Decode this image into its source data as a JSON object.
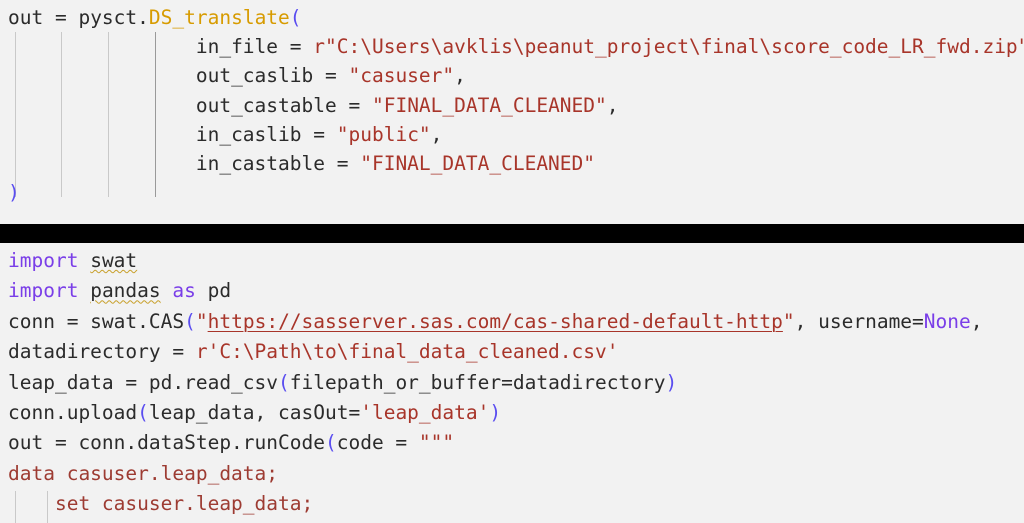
{
  "editor": {
    "background_color": "#f2f2f2",
    "separator_color": "#000000",
    "colors": {
      "plain_text": "#2b2b2b",
      "keyword": "#7a3ee8",
      "function": "#d79b00",
      "bracket": "#5a4df0",
      "string": "#a8352a",
      "argument": "#7a4fd8",
      "spellcheck_squiggle": "#c8a02a"
    }
  },
  "block_top": {
    "lines": [
      {
        "id": "line-1",
        "tokens": [
          {
            "text": "out = ",
            "style": "plain"
          },
          {
            "text": "pysct",
            "style": "plain"
          },
          {
            "text": ".",
            "style": "plain"
          },
          {
            "text": "DS_translate",
            "style": "func"
          },
          {
            "text": "(",
            "style": "paren"
          }
        ],
        "plain": "out = pysct.DS_translate("
      },
      {
        "id": "line-2",
        "tokens": [
          {
            "text": "                ",
            "style": "plain"
          },
          {
            "text": "in_file",
            "style": "arg"
          },
          {
            "text": " = ",
            "style": "plain"
          },
          {
            "text": "r",
            "style": "prefix"
          },
          {
            "text": "\"C:\\Users\\avklis\\peanut_project\\final\\score_code_LR_fwd.zip\"",
            "style": "str"
          }
        ],
        "plain": "                in_file = r\"C:\\Users\\avklis\\peanut_project\\final\\score_code_LR_fwd.zip\","
      },
      {
        "id": "line-3",
        "tokens": [
          {
            "text": "                ",
            "style": "plain"
          },
          {
            "text": "out_caslib",
            "style": "arg"
          },
          {
            "text": " = ",
            "style": "plain"
          },
          {
            "text": "\"casuser\"",
            "style": "str"
          },
          {
            "text": ",",
            "style": "plain"
          }
        ],
        "plain": "                out_caslib = \"casuser\","
      },
      {
        "id": "line-4",
        "tokens": [
          {
            "text": "                ",
            "style": "plain"
          },
          {
            "text": "out_castable",
            "style": "arg"
          },
          {
            "text": " = ",
            "style": "plain"
          },
          {
            "text": "\"FINAL_DATA_CLEANED\"",
            "style": "str"
          },
          {
            "text": ",",
            "style": "plain"
          }
        ],
        "plain": "                out_castable = \"FINAL_DATA_CLEANED\","
      },
      {
        "id": "line-5",
        "tokens": [
          {
            "text": "                ",
            "style": "plain"
          },
          {
            "text": "in_caslib",
            "style": "arg"
          },
          {
            "text": " = ",
            "style": "plain"
          },
          {
            "text": "\"public\"",
            "style": "str"
          },
          {
            "text": ",",
            "style": "plain"
          }
        ],
        "plain": "                in_caslib = \"public\","
      },
      {
        "id": "line-6",
        "tokens": [
          {
            "text": "                ",
            "style": "plain"
          },
          {
            "text": "in_castable",
            "style": "arg"
          },
          {
            "text": " = ",
            "style": "plain"
          },
          {
            "text": "\"FINAL_DATA_CLEANED\"",
            "style": "str"
          }
        ],
        "plain": "                in_castable = \"FINAL_DATA_CLEANED\""
      },
      {
        "id": "line-7",
        "tokens": [
          {
            "text": ")",
            "style": "paren"
          }
        ],
        "plain": ")"
      }
    ]
  },
  "block_bottom": {
    "lines": [
      {
        "id": "line-8",
        "tokens": [
          {
            "text": "import",
            "style": "kw"
          },
          {
            "text": " ",
            "style": "plain"
          },
          {
            "text": "swat",
            "style": "squiggle"
          }
        ],
        "plain": "import swat"
      },
      {
        "id": "line-9",
        "tokens": [
          {
            "text": "import",
            "style": "kw"
          },
          {
            "text": " ",
            "style": "plain"
          },
          {
            "text": "pandas",
            "style": "squiggle"
          },
          {
            "text": " ",
            "style": "plain"
          },
          {
            "text": "as",
            "style": "kw"
          },
          {
            "text": " ",
            "style": "plain"
          },
          {
            "text": "pd",
            "style": "plain"
          }
        ],
        "plain": "import pandas as pd"
      },
      {
        "id": "line-10",
        "tokens": [
          {
            "text": "conn = swat.",
            "style": "plain"
          },
          {
            "text": "CAS",
            "style": "plain"
          },
          {
            "text": "(",
            "style": "paren"
          },
          {
            "text": "\"",
            "style": "str"
          },
          {
            "text": "https://sasserver.sas.com/cas-shared-default-http",
            "style": "url"
          },
          {
            "text": "\"",
            "style": "str"
          },
          {
            "text": ", ",
            "style": "plain"
          },
          {
            "text": "username",
            "style": "plain"
          },
          {
            "text": "=",
            "style": "plain"
          },
          {
            "text": "None",
            "style": "kw"
          },
          {
            "text": ",",
            "style": "plain"
          }
        ],
        "plain": "conn = swat.CAS(\"https://sasserver.sas.com/cas-shared-default-http\", username=None,"
      },
      {
        "id": "line-11",
        "tokens": [
          {
            "text": "datadirectory = ",
            "style": "plain"
          },
          {
            "text": "r",
            "style": "prefix"
          },
          {
            "text": "'C:\\Path\\to\\final_data_cleaned.csv'",
            "style": "str"
          }
        ],
        "plain": "datadirectory = r'C:\\Path\\to\\final_data_cleaned.csv'"
      },
      {
        "id": "line-12",
        "tokens": [
          {
            "text": "leap_data = pd.read_csv",
            "style": "plain"
          },
          {
            "text": "(",
            "style": "paren"
          },
          {
            "text": "filepath_or_buffer",
            "style": "plain"
          },
          {
            "text": "=datadirectory",
            "style": "plain"
          },
          {
            "text": ")",
            "style": "paren"
          }
        ],
        "plain": "leap_data = pd.read_csv(filepath_or_buffer=datadirectory)"
      },
      {
        "id": "line-13",
        "tokens": [
          {
            "text": "conn.upload",
            "style": "plain"
          },
          {
            "text": "(",
            "style": "paren"
          },
          {
            "text": "leap_data, casOut=",
            "style": "plain"
          },
          {
            "text": "'leap_data'",
            "style": "str"
          },
          {
            "text": ")",
            "style": "paren"
          }
        ],
        "plain": "conn.upload(leap_data, casOut='leap_data')"
      },
      {
        "id": "line-14",
        "tokens": [
          {
            "text": "out = conn.dataStep.runCode",
            "style": "plain"
          },
          {
            "text": "(",
            "style": "paren"
          },
          {
            "text": "code = ",
            "style": "plain"
          },
          {
            "text": "\"\"\"",
            "style": "str"
          }
        ],
        "plain": "out = conn.dataStep.runCode(code = \"\"\""
      },
      {
        "id": "line-15",
        "tokens": [
          {
            "text": "data casuser.leap_data;",
            "style": "strbody"
          }
        ],
        "plain": "data casuser.leap_data;"
      },
      {
        "id": "line-16",
        "tokens": [
          {
            "text": "    set casuser.leap_data;",
            "style": "strbody"
          }
        ],
        "plain": "    set casuser.leap_data;"
      }
    ]
  }
}
